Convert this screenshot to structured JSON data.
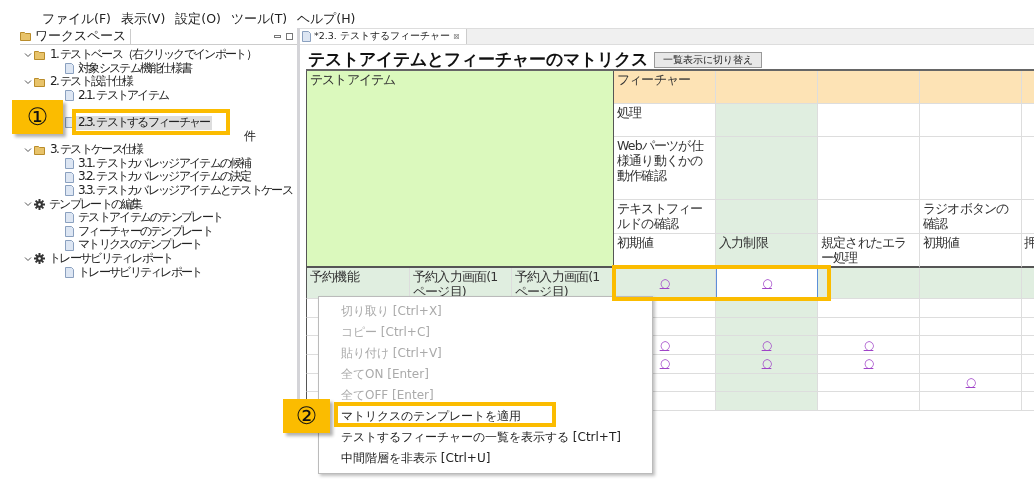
{
  "menu_bar": [
    "ファイル(F)",
    "表示(V)",
    "設定(O)",
    "ツール(T)",
    "ヘルプ(H)"
  ],
  "workspace": {
    "title": "ワークスペース",
    "tree": [
      {
        "label": "1. テストベース（右クリックでインポート）",
        "kind": "folder",
        "expanded": true,
        "selected": false,
        "children": [
          {
            "label": "対象システム機能仕様書",
            "kind": "doc",
            "selected": false
          }
        ]
      },
      {
        "label": "2. テスト設計仕様",
        "kind": "folder",
        "expanded": true,
        "selected": false,
        "children": [
          {
            "label": "2.1. テストアイテム",
            "kind": "doc",
            "selected": false
          },
          {
            "kind": "hidden"
          },
          {
            "label": "2.3. テストするフィーチャー",
            "kind": "doc",
            "selected": true
          },
          {
            "label": "件",
            "kind": "covered",
            "selected": false
          }
        ]
      },
      {
        "label": "3. テストケース仕様",
        "kind": "folder",
        "expanded": true,
        "selected": false,
        "children": [
          {
            "label": "3.1. テストカバレッジアイテムの候補",
            "kind": "doc",
            "selected": false
          },
          {
            "label": "3.2. テストカバレッジアイテムの決定",
            "kind": "doc",
            "selected": false
          },
          {
            "label": "3.3. テストカバレッジアイテムとテストケース",
            "kind": "doc",
            "selected": false
          }
        ]
      },
      {
        "label": "テンプレートの編集",
        "kind": "gear",
        "expanded": true,
        "selected": false,
        "children": [
          {
            "label": "テストアイテムのテンプレート",
            "kind": "doc",
            "selected": false
          },
          {
            "label": "フィーチャーのテンプレート",
            "kind": "doc",
            "selected": false
          },
          {
            "label": "マトリクスのテンプレート",
            "kind": "doc",
            "selected": false
          }
        ]
      },
      {
        "label": "トレーサビリティレポート",
        "kind": "gear",
        "expanded": true,
        "selected": false,
        "children": [
          {
            "label": "トレーサビリティレポート",
            "kind": "doc",
            "selected": false
          }
        ]
      }
    ]
  },
  "editor": {
    "tab": "*2.3. テストするフィーチャー",
    "tab_close": "⊠",
    "title": "テストアイテムとフィーチャーのマトリクス",
    "toggle_button": "一覧表示に切り替え",
    "test_item_header": "テストアイテム",
    "feature_columns": [
      {
        "highlighted": false
      },
      {
        "highlighted": true
      },
      {
        "highlighted": false
      },
      {
        "highlighted": false
      },
      {
        "highlighted": false
      }
    ],
    "header_rows": [
      {
        "cells": [
          {
            "text": "フィーチャー"
          },
          {},
          {},
          {},
          {}
        ]
      },
      {
        "cells": [
          {
            "text": "処理"
          },
          {},
          {},
          {},
          {}
        ]
      },
      {
        "cells": [
          {
            "text": "Webパーツが仕様通り動くかの動作確認"
          },
          {},
          {},
          {},
          {}
        ]
      },
      {
        "cells": [
          {
            "text": "テキストフィールドの確認"
          },
          {},
          {},
          {
            "text": "ラジオボタンの確認"
          },
          {}
        ]
      },
      {
        "cells": [
          {
            "text": "初期値"
          },
          {
            "text": "入力制限"
          },
          {
            "text": "規定されたエラー処理"
          },
          {
            "text": "初期値"
          },
          {
            "text": "押"
          }
        ]
      }
    ],
    "rows": [
      {
        "highlighted": true,
        "items": [
          {
            "text": "予約機能"
          },
          {
            "text": "予約入力画面(1ページ目)"
          },
          {
            "text": "予約入力画面(1ページ目)"
          }
        ],
        "cells": [
          {
            "mark": "○",
            "selected": false
          },
          {
            "mark": "○",
            "selected": true
          },
          {
            "selected": false
          },
          {
            "selected": false
          },
          {
            "selected": false
          }
        ]
      },
      {
        "highlighted": false,
        "cells": [
          {
            "selected": false
          },
          {
            "selected": false
          },
          {
            "selected": false
          },
          {
            "selected": false
          },
          {
            "selected": false
          }
        ]
      },
      {
        "highlighted": false,
        "cells": [
          {
            "selected": false
          },
          {
            "selected": false
          },
          {
            "selected": false
          },
          {
            "selected": false
          },
          {
            "selected": false
          }
        ]
      },
      {
        "highlighted": false,
        "cells": [
          {
            "mark": "○",
            "selected": false
          },
          {
            "mark": "○",
            "selected": false
          },
          {
            "mark": "○",
            "selected": false
          },
          {
            "selected": false
          },
          {
            "selected": false
          }
        ]
      },
      {
        "highlighted": false,
        "cells": [
          {
            "mark": "○",
            "selected": false
          },
          {
            "mark": "○",
            "selected": false
          },
          {
            "mark": "○",
            "selected": false
          },
          {
            "selected": false
          },
          {
            "selected": false
          }
        ]
      },
      {
        "highlighted": false,
        "cells": [
          {
            "selected": false
          },
          {
            "selected": false
          },
          {
            "selected": false
          },
          {
            "mark": "○",
            "selected": false
          },
          {
            "selected": false
          }
        ]
      },
      {
        "highlighted": false,
        "cells": [
          {
            "selected": false
          },
          {
            "selected": false
          },
          {
            "selected": false
          },
          {
            "selected": false
          },
          {
            "selected": false
          }
        ]
      }
    ]
  },
  "context_menu": [
    {
      "label": "切り取り [Ctrl+X]",
      "disabled": true
    },
    {
      "label": "コピー [Ctrl+C]",
      "disabled": true
    },
    {
      "label": "貼り付け [Ctrl+V]",
      "disabled": true
    },
    {
      "label": "全てON [Enter]",
      "disabled": true
    },
    {
      "label": "全てOFF [Enter]",
      "disabled": true
    },
    {
      "label": "マトリクスのテンプレートを適用",
      "disabled": false
    },
    {
      "label": "テストするフィーチャーの一覧を表示する [Ctrl+T]",
      "disabled": false
    },
    {
      "label": "中間階層を非表示 [Ctrl+U]",
      "disabled": false
    }
  ],
  "callouts": [
    {
      "label": "①"
    },
    {
      "label": "②"
    }
  ]
}
